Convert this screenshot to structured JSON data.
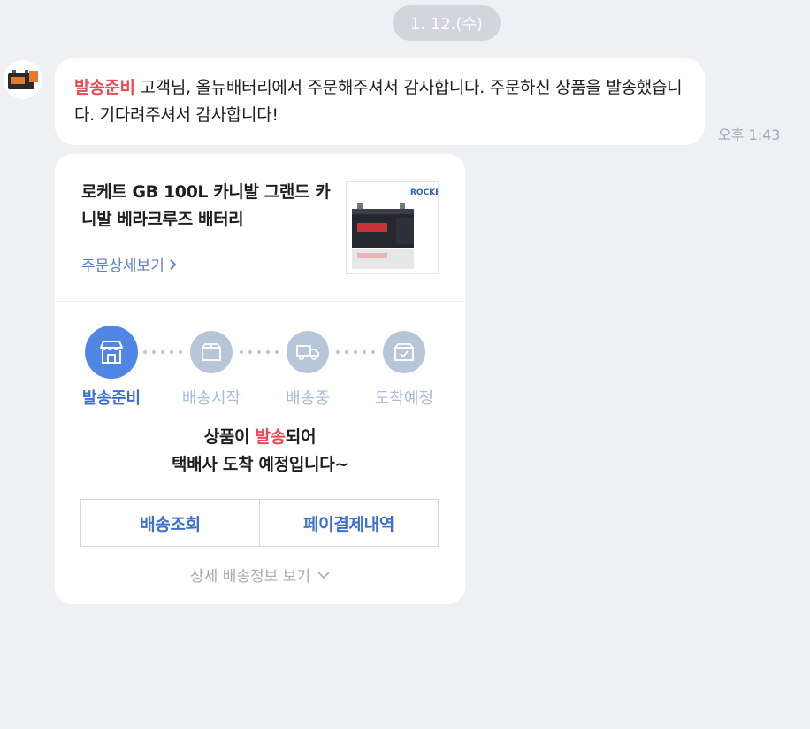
{
  "date_divider": "1. 12.(수)",
  "message": {
    "tag": "발송준비",
    "text": " 고객님, 올뉴배터리에서 주문해주셔서 감사합니다. 주문하신 상품을 발송했습니다. 기다려주셔서 감사합니다!",
    "time": "오후 1:43"
  },
  "card": {
    "product_title": "로케트 GB 100L 카니발 그랜드 카니발 베라크루즈 배터리",
    "detail_link": "주문상세보기",
    "thumb_brand": "ROCKET",
    "steps": [
      {
        "label": "발송준비",
        "icon": "store-icon",
        "active": true
      },
      {
        "label": "배송시작",
        "icon": "box-icon",
        "active": false
      },
      {
        "label": "배송중",
        "icon": "truck-icon",
        "active": false
      },
      {
        "label": "도착예정",
        "icon": "box-check-icon",
        "active": false
      }
    ],
    "status_line1_pre": "상품이 ",
    "status_line1_hl": "발송",
    "status_line1_post": "되어",
    "status_line2": "택배사 도착 예정입니다~",
    "buttons": {
      "track": "배송조회",
      "pay_history": "페이결제내역"
    },
    "more_link": "상세 배송정보 보기"
  },
  "colors": {
    "accent": "#4f86e6",
    "tag_red": "#e84b54",
    "inactive": "#b6c6d8",
    "background": "#eff0f4"
  }
}
